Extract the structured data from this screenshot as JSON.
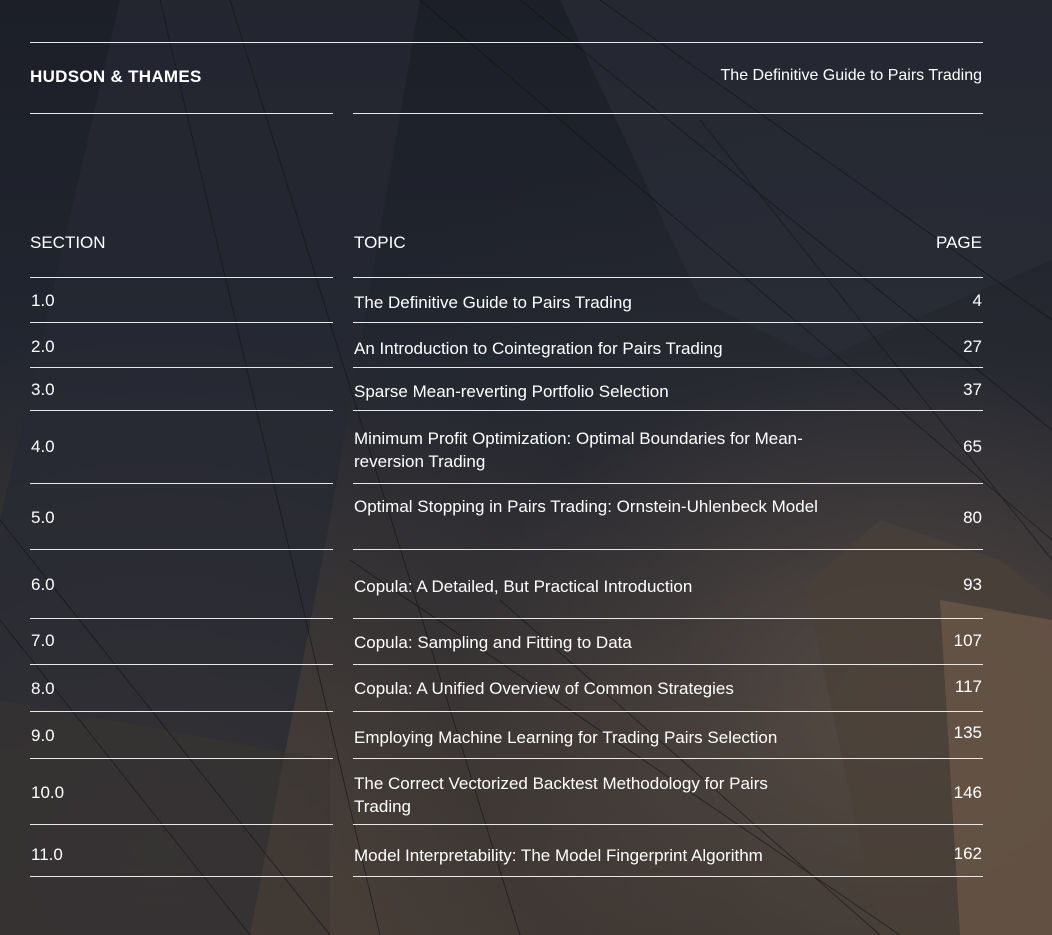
{
  "header": {
    "brand": "HUDSON & THAMES",
    "doc_title": "The Definitive Guide to Pairs Trading"
  },
  "columns": {
    "section": "SECTION",
    "topic": "TOPIC",
    "page": "PAGE"
  },
  "rows": [
    {
      "section": "1.0",
      "topic": "The Definitive Guide to Pairs Trading",
      "page": "4"
    },
    {
      "section": "2.0",
      "topic": "An Introduction to Cointegration for Pairs Trading",
      "page": "27"
    },
    {
      "section": "3.0",
      "topic": "Sparse Mean-reverting Portfolio Selection",
      "page": "37"
    },
    {
      "section": "4.0",
      "topic": "Minimum Profit Optimization: Optimal Boundaries for Mean-reversion Trading",
      "page": "65"
    },
    {
      "section": "5.0",
      "topic": "Optimal Stopping in Pairs Trading: Ornstein-Uhlenbeck Model",
      "page": "80"
    },
    {
      "section": "6.0",
      "topic": "Copula: A Detailed, But Practical Introduction",
      "page": "93"
    },
    {
      "section": "7.0",
      "topic": "Copula: Sampling and Fitting to Data",
      "page": "107"
    },
    {
      "section": "8.0",
      "topic": "Copula: A Unified Overview of Common Strategies",
      "page": "117"
    },
    {
      "section": "9.0",
      "topic": "Employing Machine Learning for Trading Pairs Selection",
      "page": "135"
    },
    {
      "section": "10.0",
      "topic": "The Correct Vectorized Backtest Methodology for Pairs Trading",
      "page": "146"
    },
    {
      "section": "11.0",
      "topic": "Model Interpretability: The Model Fingerprint Algorithm",
      "page": "162"
    }
  ]
}
